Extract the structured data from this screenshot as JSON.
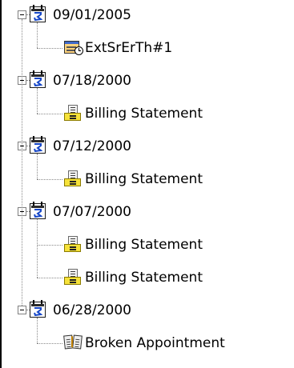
{
  "tree": [
    {
      "date": "09/01/2005",
      "children": [
        {
          "label": "ExtSrErTh#1",
          "icon": "server-event-icon"
        }
      ]
    },
    {
      "date": "07/18/2000",
      "children": [
        {
          "label": "Billing Statement",
          "icon": "billing-statement-icon"
        }
      ]
    },
    {
      "date": "07/12/2000",
      "children": [
        {
          "label": "Billing Statement",
          "icon": "billing-statement-icon"
        }
      ]
    },
    {
      "date": "07/07/2000",
      "children": [
        {
          "label": "Billing Statement",
          "icon": "billing-statement-icon"
        },
        {
          "label": "Billing Statement",
          "icon": "billing-statement-icon"
        }
      ]
    },
    {
      "date": "06/28/2000",
      "children": [
        {
          "label": "Broken Appointment",
          "icon": "broken-appointment-icon"
        }
      ]
    }
  ],
  "icons": {
    "date_node": "calendar-icon",
    "expander": "collapse-minus-icon"
  },
  "colors": {
    "background": "#ffffff",
    "text": "#000000",
    "tree_lines": "#8a8a8a",
    "billing_tray": "#f6e23a"
  }
}
